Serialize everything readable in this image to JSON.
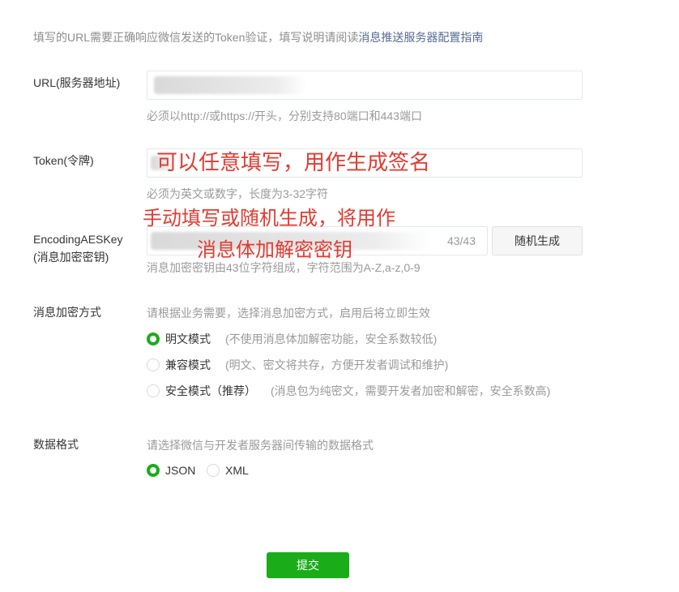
{
  "intro": {
    "text": "填写的URL需要正确响应微信发送的Token验证，填写说明请阅读",
    "link": "消息推送服务器配置指南"
  },
  "url_field": {
    "label": "URL(服务器地址)",
    "hint": "必须以http://或https://开头，分别支持80端口和443端口"
  },
  "token_field": {
    "label": "Token(令牌)",
    "annotation": "可以任意填写，用作生成签名",
    "hint": "必须为英文或数字，长度为3-32字符"
  },
  "aes_field": {
    "label_line1": "EncodingAESKey",
    "label_line2": "(消息加密密钥)",
    "annotation_line1": "手动填写或随机生成，将用作",
    "annotation_line2": "消息体加解密密钥",
    "counter": "43/43",
    "random_button": "随机生成",
    "hint": "消息加密密钥由43位字符组成，字符范围为A-Z,a-z,0-9"
  },
  "encryption": {
    "label": "消息加密方式",
    "hint": "请根据业务需要，选择消息加密方式，启用后将立即生效",
    "options": [
      {
        "label": "明文模式",
        "desc": "(不使用消息体加解密功能，安全系数较低)",
        "selected": true
      },
      {
        "label": "兼容模式",
        "desc": "(明文、密文将共存，方便开发者调试和维护)",
        "selected": false
      },
      {
        "label": "安全模式（推荐）",
        "desc": "(消息包为纯密文，需要开发者加密和解密，安全系数高)",
        "selected": false
      }
    ]
  },
  "data_format": {
    "label": "数据格式",
    "hint": "请选择微信与开发者服务器间传输的数据格式",
    "options": [
      {
        "label": "JSON",
        "selected": true
      },
      {
        "label": "XML",
        "selected": false
      }
    ]
  },
  "submit_label": "提交",
  "colors": {
    "accent": "#1aad19",
    "link": "#576b95",
    "annotation": "#e23b32"
  }
}
